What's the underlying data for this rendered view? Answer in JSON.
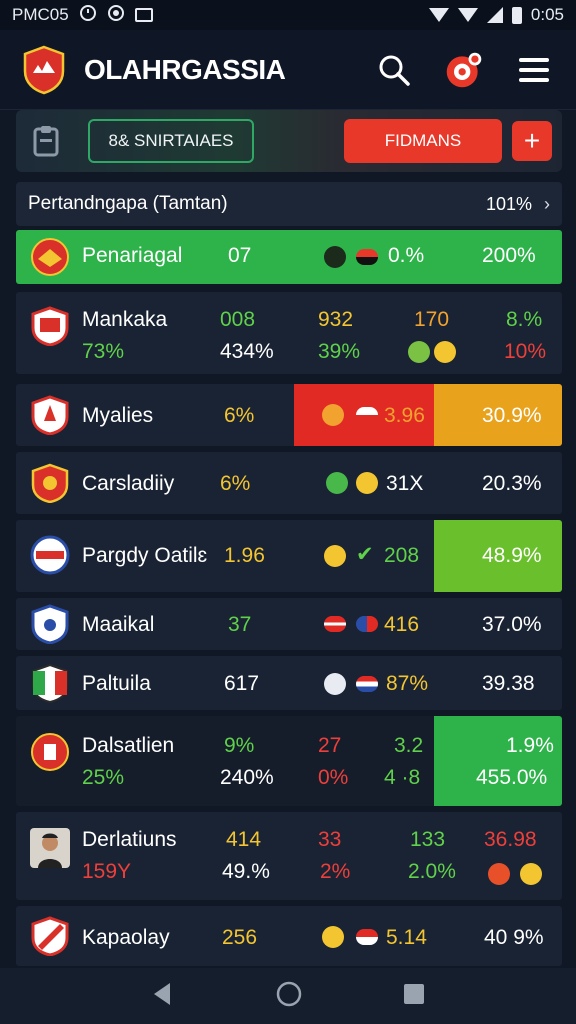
{
  "status_bar": {
    "time_left": "PMC05",
    "time_right": "0:05"
  },
  "app": {
    "title": "OLAHRGASSIA"
  },
  "toolbar": {
    "outline_label": "8& SNIRTAIAES",
    "red_label": "FIDMANS",
    "plus_label": "+"
  },
  "filter": {
    "label": "Pertandngapa (Tamtan)",
    "value": "101%",
    "chevron": "›"
  },
  "rows": [
    {
      "team": "Penariagal",
      "c1": "07",
      "c2": "0.%",
      "c3": "200%"
    },
    {
      "team": "Mankaka",
      "c1": "008",
      "c2": "932",
      "c3": "170",
      "c4": "8.%",
      "sub": "73%",
      "s1": "434%",
      "s2": "39%",
      "s3": "10%"
    },
    {
      "team": "Myalies",
      "c1": "6%",
      "c2": "3.96",
      "c3": "30.9%"
    },
    {
      "team": "Carsladiiy",
      "c1": "6%",
      "c2": "31X",
      "c3": "20.3%"
    },
    {
      "team": "Pargdy Oatilɛ",
      "c1": "1.96",
      "c2": "208",
      "c3": "48.9%"
    },
    {
      "team": "Maaikal",
      "c1": "37",
      "c2": "416",
      "c3": "37.0%"
    },
    {
      "team": "Paltuila",
      "c1": "617",
      "c2": "87%",
      "c3": "39.38"
    },
    {
      "team": "Dalsatlien",
      "c1": "9%",
      "c2": "27",
      "c3": "3.2",
      "c4": "1.9%",
      "sub": "25%",
      "s1": "240%",
      "s2": "0%",
      "s3": "4 ·8",
      "s4": "455.0%"
    },
    {
      "team": "Derlatiuns",
      "c1": "414",
      "c2": "33",
      "c3": "133",
      "c4": "36.98",
      "sub": "159Y",
      "s1": "49.%",
      "s2": "2%",
      "s3": "2.0%"
    },
    {
      "team": "Kapaolay",
      "c1": "256",
      "c2": "5.14",
      "c3": "40 9%"
    }
  ],
  "colors": {
    "accent_green": "#2fb84a",
    "accent_red": "#e8382a",
    "accent_orange": "#e8a21c",
    "background": "#101826"
  },
  "icons": [
    "search-icon",
    "notification-badge-icon",
    "menu-icon",
    "back-icon",
    "home-icon",
    "recents-icon"
  ]
}
